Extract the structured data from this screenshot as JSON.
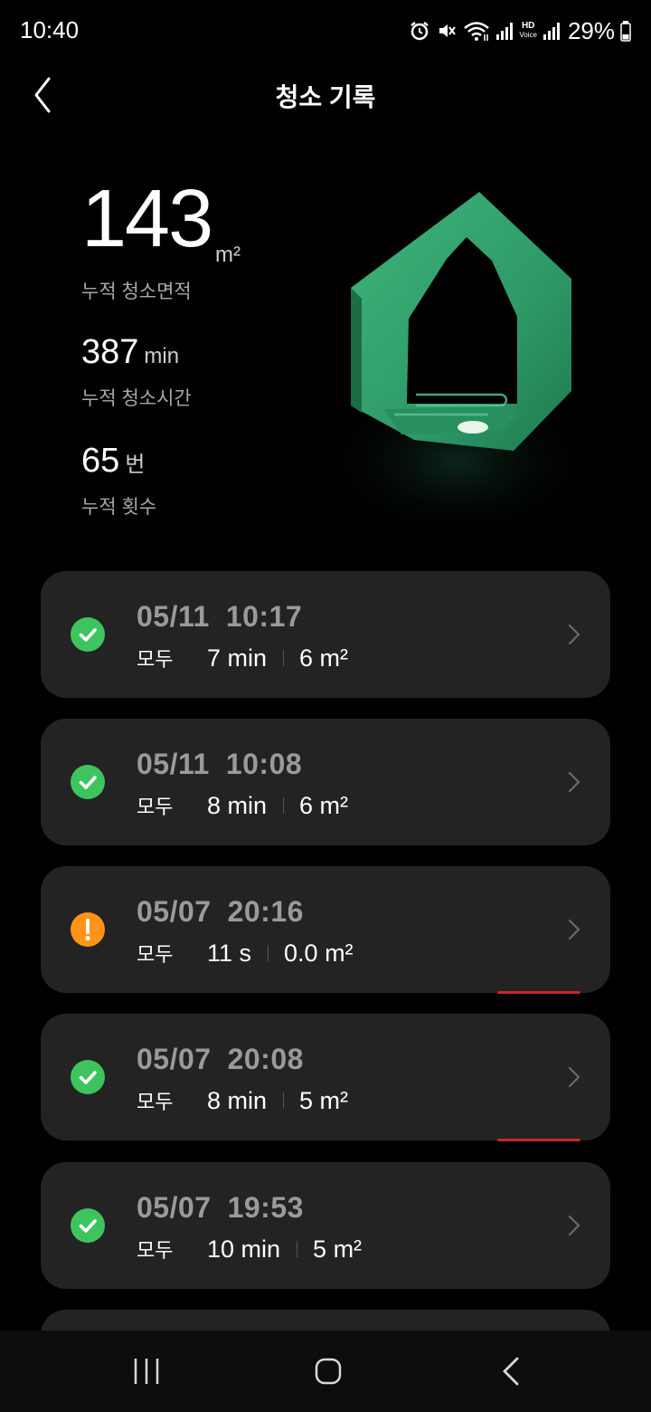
{
  "status_bar": {
    "time": "10:40",
    "battery": "29%",
    "icons": [
      "alarm-icon",
      "mute-icon",
      "wifi-icon",
      "signal-icon",
      "hd-voice-icon",
      "signal-icon",
      "battery-icon"
    ],
    "hd_label": "HD",
    "voice_label": "Voice"
  },
  "header": {
    "title": "청소 기록",
    "back_icon": "chevron-left-icon"
  },
  "stats": {
    "area_value": "143",
    "area_unit": "m²",
    "area_label": "누적 청소면적",
    "time_value": "387",
    "time_unit": "min",
    "time_label": "누적 청소시간",
    "count_value": "65",
    "count_unit": "번",
    "count_label": "누적 횟수"
  },
  "colors": {
    "success": "#3ec45e",
    "warning": "#ff9418",
    "card_bg": "#232323",
    "house_green": "#2e9a67"
  },
  "records": [
    {
      "date": "05/11",
      "time": "10:17",
      "mode": "모두",
      "duration": "7 min",
      "area": "6 m²",
      "status": "success"
    },
    {
      "date": "05/11",
      "time": "10:08",
      "mode": "모두",
      "duration": "8 min",
      "area": "6 m²",
      "status": "success"
    },
    {
      "date": "05/07",
      "time": "20:16",
      "mode": "모두",
      "duration": "11 s",
      "area": "0.0 m²",
      "status": "warning"
    },
    {
      "date": "05/07",
      "time": "20:08",
      "mode": "모두",
      "duration": "8 min",
      "area": "5 m²",
      "status": "success"
    },
    {
      "date": "05/07",
      "time": "19:53",
      "mode": "모두",
      "duration": "10 min",
      "area": "5 m²",
      "status": "success"
    }
  ],
  "nav": {
    "recents_icon": "recents-icon",
    "home_icon": "home-icon",
    "back_icon": "back-icon"
  }
}
